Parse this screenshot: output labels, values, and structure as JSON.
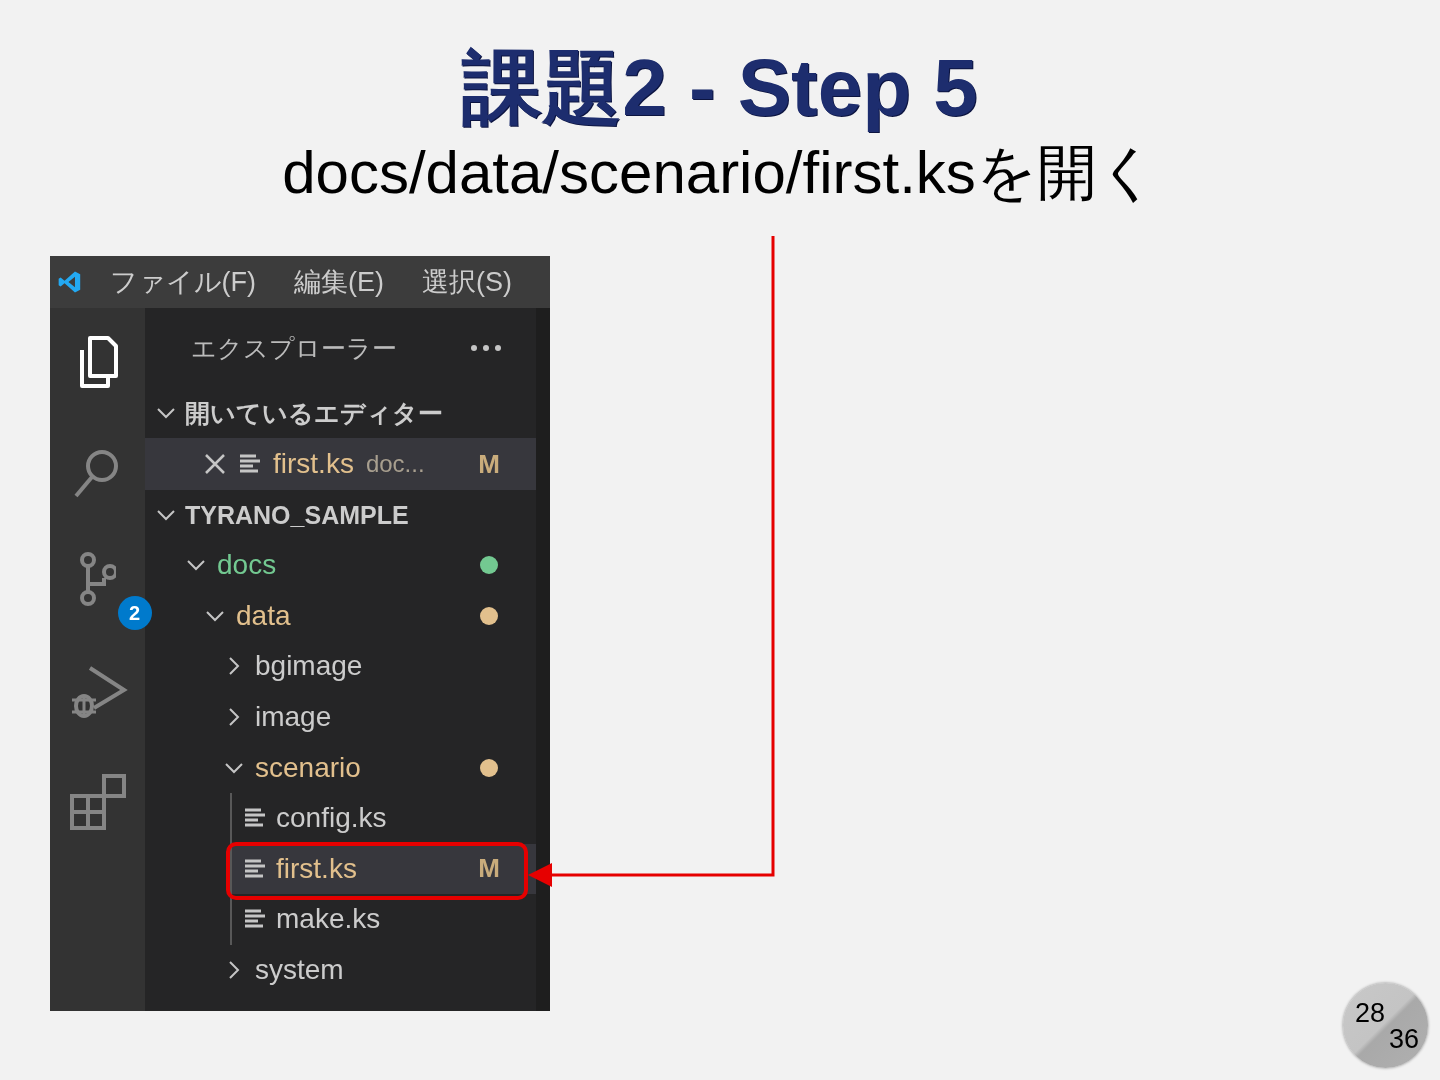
{
  "slide": {
    "title": "課題2 - Step 5",
    "subtitle": "docs/data/scenario/first.ksを開く",
    "page": "28",
    "total": "36"
  },
  "window": {
    "menu": [
      "ファイル(F)",
      "編集(E)",
      "選択(S)"
    ]
  },
  "activity_bar": [
    {
      "kind": "explorer",
      "selected": true
    },
    {
      "kind": "search",
      "selected": false
    },
    {
      "kind": "source-control",
      "selected": false,
      "badge": "2"
    },
    {
      "kind": "run-debug",
      "selected": false
    },
    {
      "kind": "extensions",
      "selected": false
    }
  ],
  "sidebar": {
    "title": "エクスプローラー",
    "sections": [
      {
        "kind": "open-editors",
        "title": "開いているエディター",
        "expanded": true,
        "items": [
          {
            "name": "first.ks",
            "path": "doc...",
            "status": "M",
            "color": "#e2c08d",
            "selected": true
          }
        ]
      },
      {
        "kind": "tree",
        "title": "TYRANO_SAMPLE",
        "expanded": true,
        "items": [
          {
            "kind": "folder",
            "name": "docs",
            "expanded": true,
            "color": "#73c991",
            "dot": true,
            "selected": false,
            "children": [
              {
                "kind": "folder",
                "name": "data",
                "expanded": true,
                "color": "#e2c08d",
                "dot": true,
                "selected": false,
                "children": [
                  {
                    "kind": "folder",
                    "name": "bgimage",
                    "expanded": false,
                    "selected": false
                  },
                  {
                    "kind": "folder",
                    "name": "image",
                    "expanded": false,
                    "selected": false
                  },
                  {
                    "kind": "folder",
                    "name": "scenario",
                    "expanded": true,
                    "color": "#e2c08d",
                    "dot": true,
                    "selected": false,
                    "children": [
                      {
                        "kind": "file",
                        "name": "config.ks",
                        "selected": false
                      },
                      {
                        "kind": "file",
                        "name": "first.ks",
                        "status": "M",
                        "color": "#e2c08d",
                        "selected": true,
                        "highlighted": true
                      },
                      {
                        "kind": "file",
                        "name": "make.ks",
                        "selected": false
                      }
                    ]
                  },
                  {
                    "kind": "folder",
                    "name": "system",
                    "expanded": false,
                    "selected": false
                  }
                ]
              }
            ]
          }
        ]
      }
    ]
  }
}
